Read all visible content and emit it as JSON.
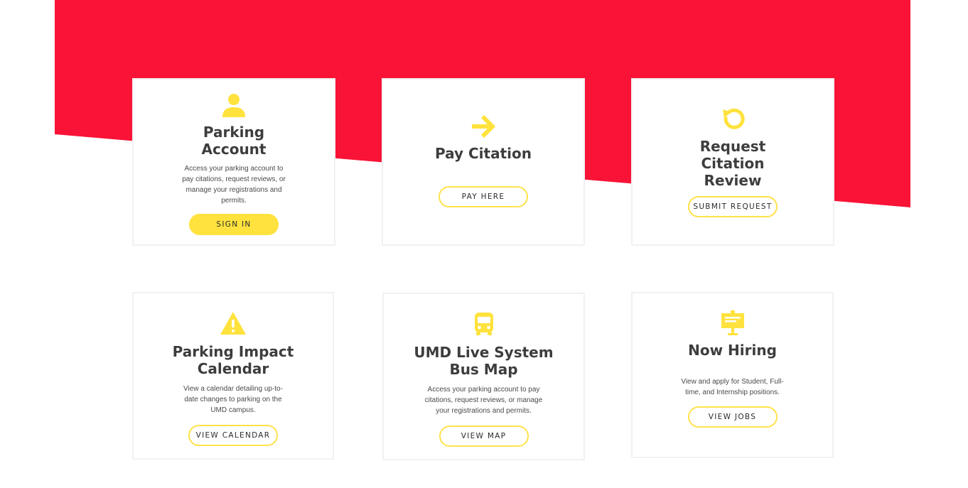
{
  "theme": {
    "accent_red": "#f91336",
    "accent_yellow": "#ffe23d",
    "card_border": "#f1f1f1",
    "text_dark": "#3d3d3d"
  },
  "cards": [
    {
      "icon": "person-icon",
      "title_lines": [
        "Parking",
        "Account"
      ],
      "description_lines": [
        "Access your parking account to",
        "pay citations, request reviews, or",
        "manage your registrations and",
        "permits."
      ],
      "button": "SIGN IN",
      "button_style": "filled"
    },
    {
      "icon": "arrow-right-icon",
      "title_lines": [
        "Pay Citation"
      ],
      "description_lines": [],
      "button": "PAY HERE",
      "button_style": "outline"
    },
    {
      "icon": "refresh-icon",
      "title_lines": [
        "Request",
        "Citation",
        "Review"
      ],
      "description_lines": [],
      "button": "SUBMIT REQUEST",
      "button_style": "outline"
    },
    {
      "icon": "warning-icon",
      "title_lines": [
        "Parking Impact",
        "Calendar"
      ],
      "description_lines": [
        "View a calendar detailing up-to-",
        "date changes to parking on the",
        "UMD campus."
      ],
      "button": "VIEW CALENDAR",
      "button_style": "outline"
    },
    {
      "icon": "bus-icon",
      "title_lines": [
        "UMD Live System",
        "Bus Map"
      ],
      "description_lines": [
        "Access your parking account to pay",
        "citations, request reviews, or manage",
        "your registrations and permits."
      ],
      "button": "VIEW MAP",
      "button_style": "outline"
    },
    {
      "icon": "job-sign-icon",
      "title_lines": [
        "Now Hiring"
      ],
      "description_lines": [
        "View and apply for Student, Full-",
        "time, and Internship positions."
      ],
      "button": "VIEW JOBS",
      "button_style": "outline"
    }
  ]
}
